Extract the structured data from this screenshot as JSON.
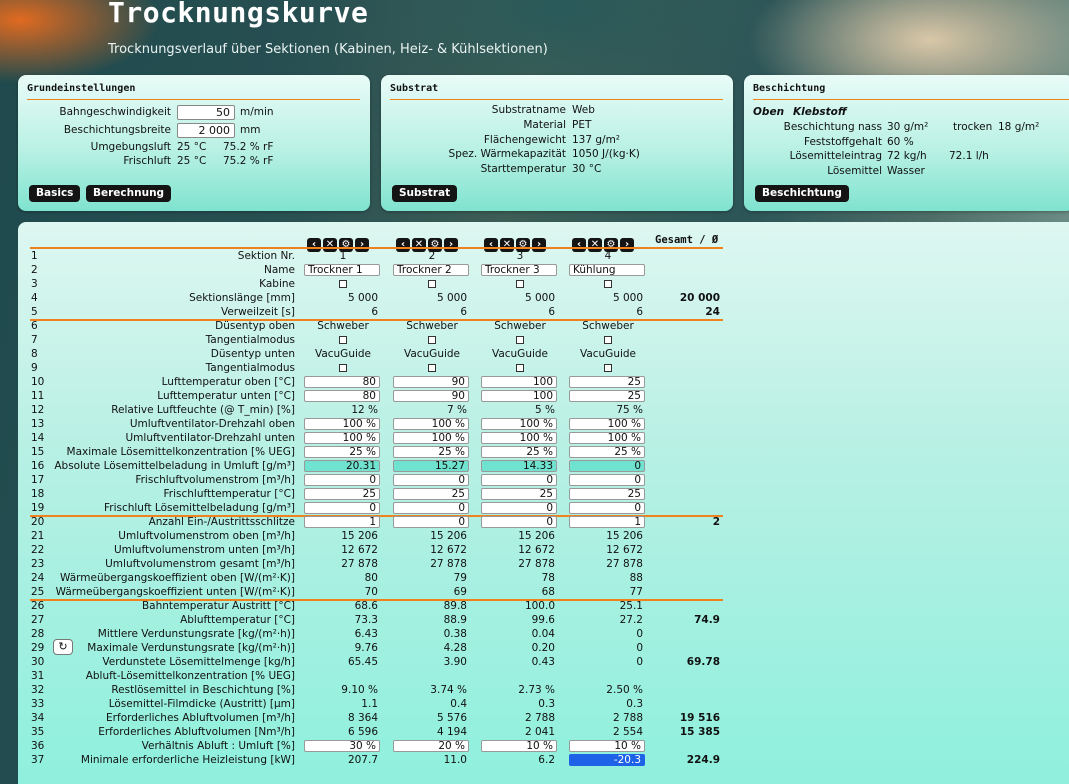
{
  "header": {
    "title": "Trocknungskurve",
    "subtitle": "Trocknungsverlauf über Sektionen (Kabinen, Heiz- & Kühlsektionen)"
  },
  "grund": {
    "title": "Grundeinstellungen",
    "bahn_label": "Bahngeschwindigkeit",
    "bahn_val": "50",
    "bahn_unit": "m/min",
    "breite_label": "Beschichtungsbreite",
    "breite_val": "2 000",
    "breite_unit": "mm",
    "uml_label": "Umgebungsluft",
    "uml_t": "25 °C",
    "uml_h": "75.2 % rF",
    "fri_label": "Frischluft",
    "fri_t": "25 °C",
    "fri_h": "75.2 % rF",
    "btn_basics": "Basics",
    "btn_calc": "Berechnung"
  },
  "substrat": {
    "title": "Substrat",
    "name_l": "Substratname",
    "name_v": "Web",
    "mat_l": "Material",
    "mat_v": "PET",
    "fg_l": "Flächengewicht",
    "fg_v": "137 g/m²",
    "wk_l": "Spez. Wärmekapazität",
    "wk_v": "1050 J/(kg·K)",
    "st_l": "Starttemperatur",
    "st_v": "30 °C",
    "btn": "Substrat"
  },
  "besch": {
    "title": "Beschichtung",
    "oben": "Oben",
    "kleb": "Klebstoff",
    "nass_l": "Beschichtung nass",
    "nass_v": "30 g/m²",
    "trocken_l": "trocken",
    "trocken_v": "18 g/m²",
    "fest_l": "Feststoffgehalt",
    "fest_v": "60 %",
    "loe_l": "Lösemitteleintrag",
    "loe_v": "72 kg/h",
    "loe_v2": "72.1 l/h",
    "lm_l": "Lösemittel",
    "lm_v": "Wasser",
    "btn": "Beschichtung"
  },
  "controls": {
    "prev": "‹",
    "del": "✕",
    "cfg": "⚙",
    "next": "›"
  },
  "gesamt": "Gesamt / Ø",
  "refresh_icon": "↻",
  "rows": [
    {
      "n": "1",
      "l": "Sektion Nr.",
      "t": "center",
      "v": [
        "1",
        "2",
        "3",
        "4"
      ],
      "tot": ""
    },
    {
      "n": "2",
      "l": "Name",
      "t": "text",
      "v": [
        "Trockner 1",
        "Trockner 2",
        "Trockner 3",
        "Kühlung"
      ],
      "tot": ""
    },
    {
      "n": "3",
      "l": "Kabine",
      "t": "check",
      "v": [
        "",
        "",
        "",
        ""
      ],
      "tot": ""
    },
    {
      "n": "4",
      "l": "Sektionslänge [mm]",
      "t": "val",
      "v": [
        "5 000",
        "5 000",
        "5 000",
        "5 000"
      ],
      "tot": "20 000"
    },
    {
      "n": "5",
      "l": "Verweilzeit [s]",
      "t": "val",
      "v": [
        "6",
        "6",
        "6",
        "6"
      ],
      "tot": "24"
    },
    {
      "n": "6",
      "l": "Düsentyp oben",
      "t": "center",
      "v": [
        "Schweber",
        "Schweber",
        "Schweber",
        "Schweber"
      ],
      "tot": ""
    },
    {
      "n": "7",
      "l": "Tangentialmodus",
      "t": "check",
      "v": [
        "",
        "",
        "",
        ""
      ],
      "tot": ""
    },
    {
      "n": "8",
      "l": "Düsentyp unten",
      "t": "center",
      "v": [
        "VacuGuide",
        "VacuGuide",
        "VacuGuide",
        "VacuGuide"
      ],
      "tot": ""
    },
    {
      "n": "9",
      "l": "Tangentialmodus",
      "t": "check",
      "v": [
        "",
        "",
        "",
        ""
      ],
      "tot": ""
    },
    {
      "n": "10",
      "l": "Lufttemperatur oben [°C]",
      "t": "input",
      "v": [
        "80",
        "90",
        "100",
        "25"
      ],
      "tot": ""
    },
    {
      "n": "11",
      "l": "Lufttemperatur unten [°C]",
      "t": "input",
      "v": [
        "80",
        "90",
        "100",
        "25"
      ],
      "tot": ""
    },
    {
      "n": "12",
      "l": "Relative Luftfeuchte (@ T_min) [%]",
      "t": "val",
      "v": [
        "12 %",
        "7 %",
        "5 %",
        "75 %"
      ],
      "tot": ""
    },
    {
      "n": "13",
      "l": "Umluftventilator-Drehzahl oben",
      "t": "input",
      "v": [
        "100 %",
        "100 %",
        "100 %",
        "100 %"
      ],
      "tot": ""
    },
    {
      "n": "14",
      "l": "Umluftventilator-Drehzahl unten",
      "t": "input",
      "v": [
        "100 %",
        "100 %",
        "100 %",
        "100 %"
      ],
      "tot": ""
    },
    {
      "n": "15",
      "l": "Maximale Lösemittelkonzentration [% UEG]",
      "t": "input",
      "v": [
        "25 %",
        "25 %",
        "25 %",
        "25 %"
      ],
      "tot": ""
    },
    {
      "n": "16",
      "l": "Absolute Lösemittelbeladung in Umluft [g/m³]",
      "t": "teal",
      "v": [
        "20.31",
        "15.27",
        "14.33",
        "0"
      ],
      "tot": ""
    },
    {
      "n": "17",
      "l": "Frischluftvolumenstrom [m³/h]",
      "t": "input",
      "v": [
        "0",
        "0",
        "0",
        "0"
      ],
      "tot": ""
    },
    {
      "n": "18",
      "l": "Frischlufttemperatur [°C]",
      "t": "input",
      "v": [
        "25",
        "25",
        "25",
        "25"
      ],
      "tot": ""
    },
    {
      "n": "19",
      "l": "Frischluft Lösemittelbeladung [g/m³]",
      "t": "input",
      "v": [
        "0",
        "0",
        "0",
        "0"
      ],
      "tot": ""
    },
    {
      "n": "20",
      "l": "Anzahl Ein-/Austrittsschlitze",
      "t": "input",
      "v": [
        "1",
        "0",
        "0",
        "1"
      ],
      "tot": "2"
    },
    {
      "n": "21",
      "l": "Umluftvolumenstrom oben [m³/h]",
      "t": "val",
      "v": [
        "15 206",
        "15 206",
        "15 206",
        "15 206"
      ],
      "tot": ""
    },
    {
      "n": "22",
      "l": "Umluftvolumenstrom unten [m³/h]",
      "t": "val",
      "v": [
        "12 672",
        "12 672",
        "12 672",
        "12 672"
      ],
      "tot": ""
    },
    {
      "n": "23",
      "l": "Umluftvolumenstrom gesamt [m³/h]",
      "t": "val",
      "v": [
        "27 878",
        "27 878",
        "27 878",
        "27 878"
      ],
      "tot": ""
    },
    {
      "n": "24",
      "l": "Wärmeübergangskoeffizient oben [W/(m²·K)]",
      "t": "val",
      "v": [
        "80",
        "79",
        "78",
        "88"
      ],
      "tot": ""
    },
    {
      "n": "25",
      "l": "Wärmeübergangskoeffizient unten [W/(m²·K)]",
      "t": "val",
      "v": [
        "70",
        "69",
        "68",
        "77"
      ],
      "tot": ""
    },
    {
      "n": "26",
      "l": "Bahntemperatur Austritt [°C]",
      "t": "val",
      "v": [
        "68.6",
        "89.8",
        "100.0",
        "25.1"
      ],
      "tot": ""
    },
    {
      "n": "27",
      "l": "Ablufttemperatur [°C]",
      "t": "val",
      "v": [
        "73.3",
        "88.9",
        "99.6",
        "27.2"
      ],
      "tot": "74.9"
    },
    {
      "n": "28",
      "l": "Mittlere Verdunstungsrate [kg/(m²·h)]",
      "t": "val",
      "v": [
        "6.43",
        "0.38",
        "0.04",
        "0"
      ],
      "tot": ""
    },
    {
      "n": "29",
      "l": "Maximale Verdunstungsrate [kg/(m²·h)]",
      "t": "val",
      "v": [
        "9.76",
        "4.28",
        "0.20",
        "0"
      ],
      "tot": ""
    },
    {
      "n": "30",
      "l": "Verdunstete Lösemittelmenge [kg/h]",
      "t": "val",
      "v": [
        "65.45",
        "3.90",
        "0.43",
        "0"
      ],
      "tot": "69.78"
    },
    {
      "n": "31",
      "l": "Abluft-Lösemittelkonzentration [% UEG]",
      "t": "val",
      "v": [
        "",
        "",
        "",
        ""
      ],
      "tot": ""
    },
    {
      "n": "32",
      "l": "Restlösemittel in Beschichtung [%]",
      "t": "val",
      "v": [
        "9.10 %",
        "3.74 %",
        "2.73 %",
        "2.50 %"
      ],
      "tot": ""
    },
    {
      "n": "33",
      "l": "Lösemittel-Filmdicke (Austritt) [µm]",
      "t": "val",
      "v": [
        "1.1",
        "0.4",
        "0.3",
        "0.3"
      ],
      "tot": ""
    },
    {
      "n": "34",
      "l": "Erforderliches Abluftvolumen [m³/h]",
      "t": "val",
      "v": [
        "8 364",
        "5 576",
        "2 788",
        "2 788"
      ],
      "tot": "19 516"
    },
    {
      "n": "35",
      "l": "Erforderliches Abluftvolumen [Nm³/h]",
      "t": "val",
      "v": [
        "6 596",
        "4 194",
        "2 041",
        "2 554"
      ],
      "tot": "15 385"
    },
    {
      "n": "36",
      "l": "Verhältnis Abluft : Umluft [%]",
      "t": "input",
      "v": [
        "30 %",
        "20 %",
        "10 %",
        "10 %"
      ],
      "tot": ""
    },
    {
      "n": "37",
      "l": "Minimale erforderliche Heizleistung [kW]",
      "t": "mixed",
      "v": [
        "207.7",
        "11.0",
        "6.2",
        "-20.3"
      ],
      "tot": "224.9"
    }
  ]
}
